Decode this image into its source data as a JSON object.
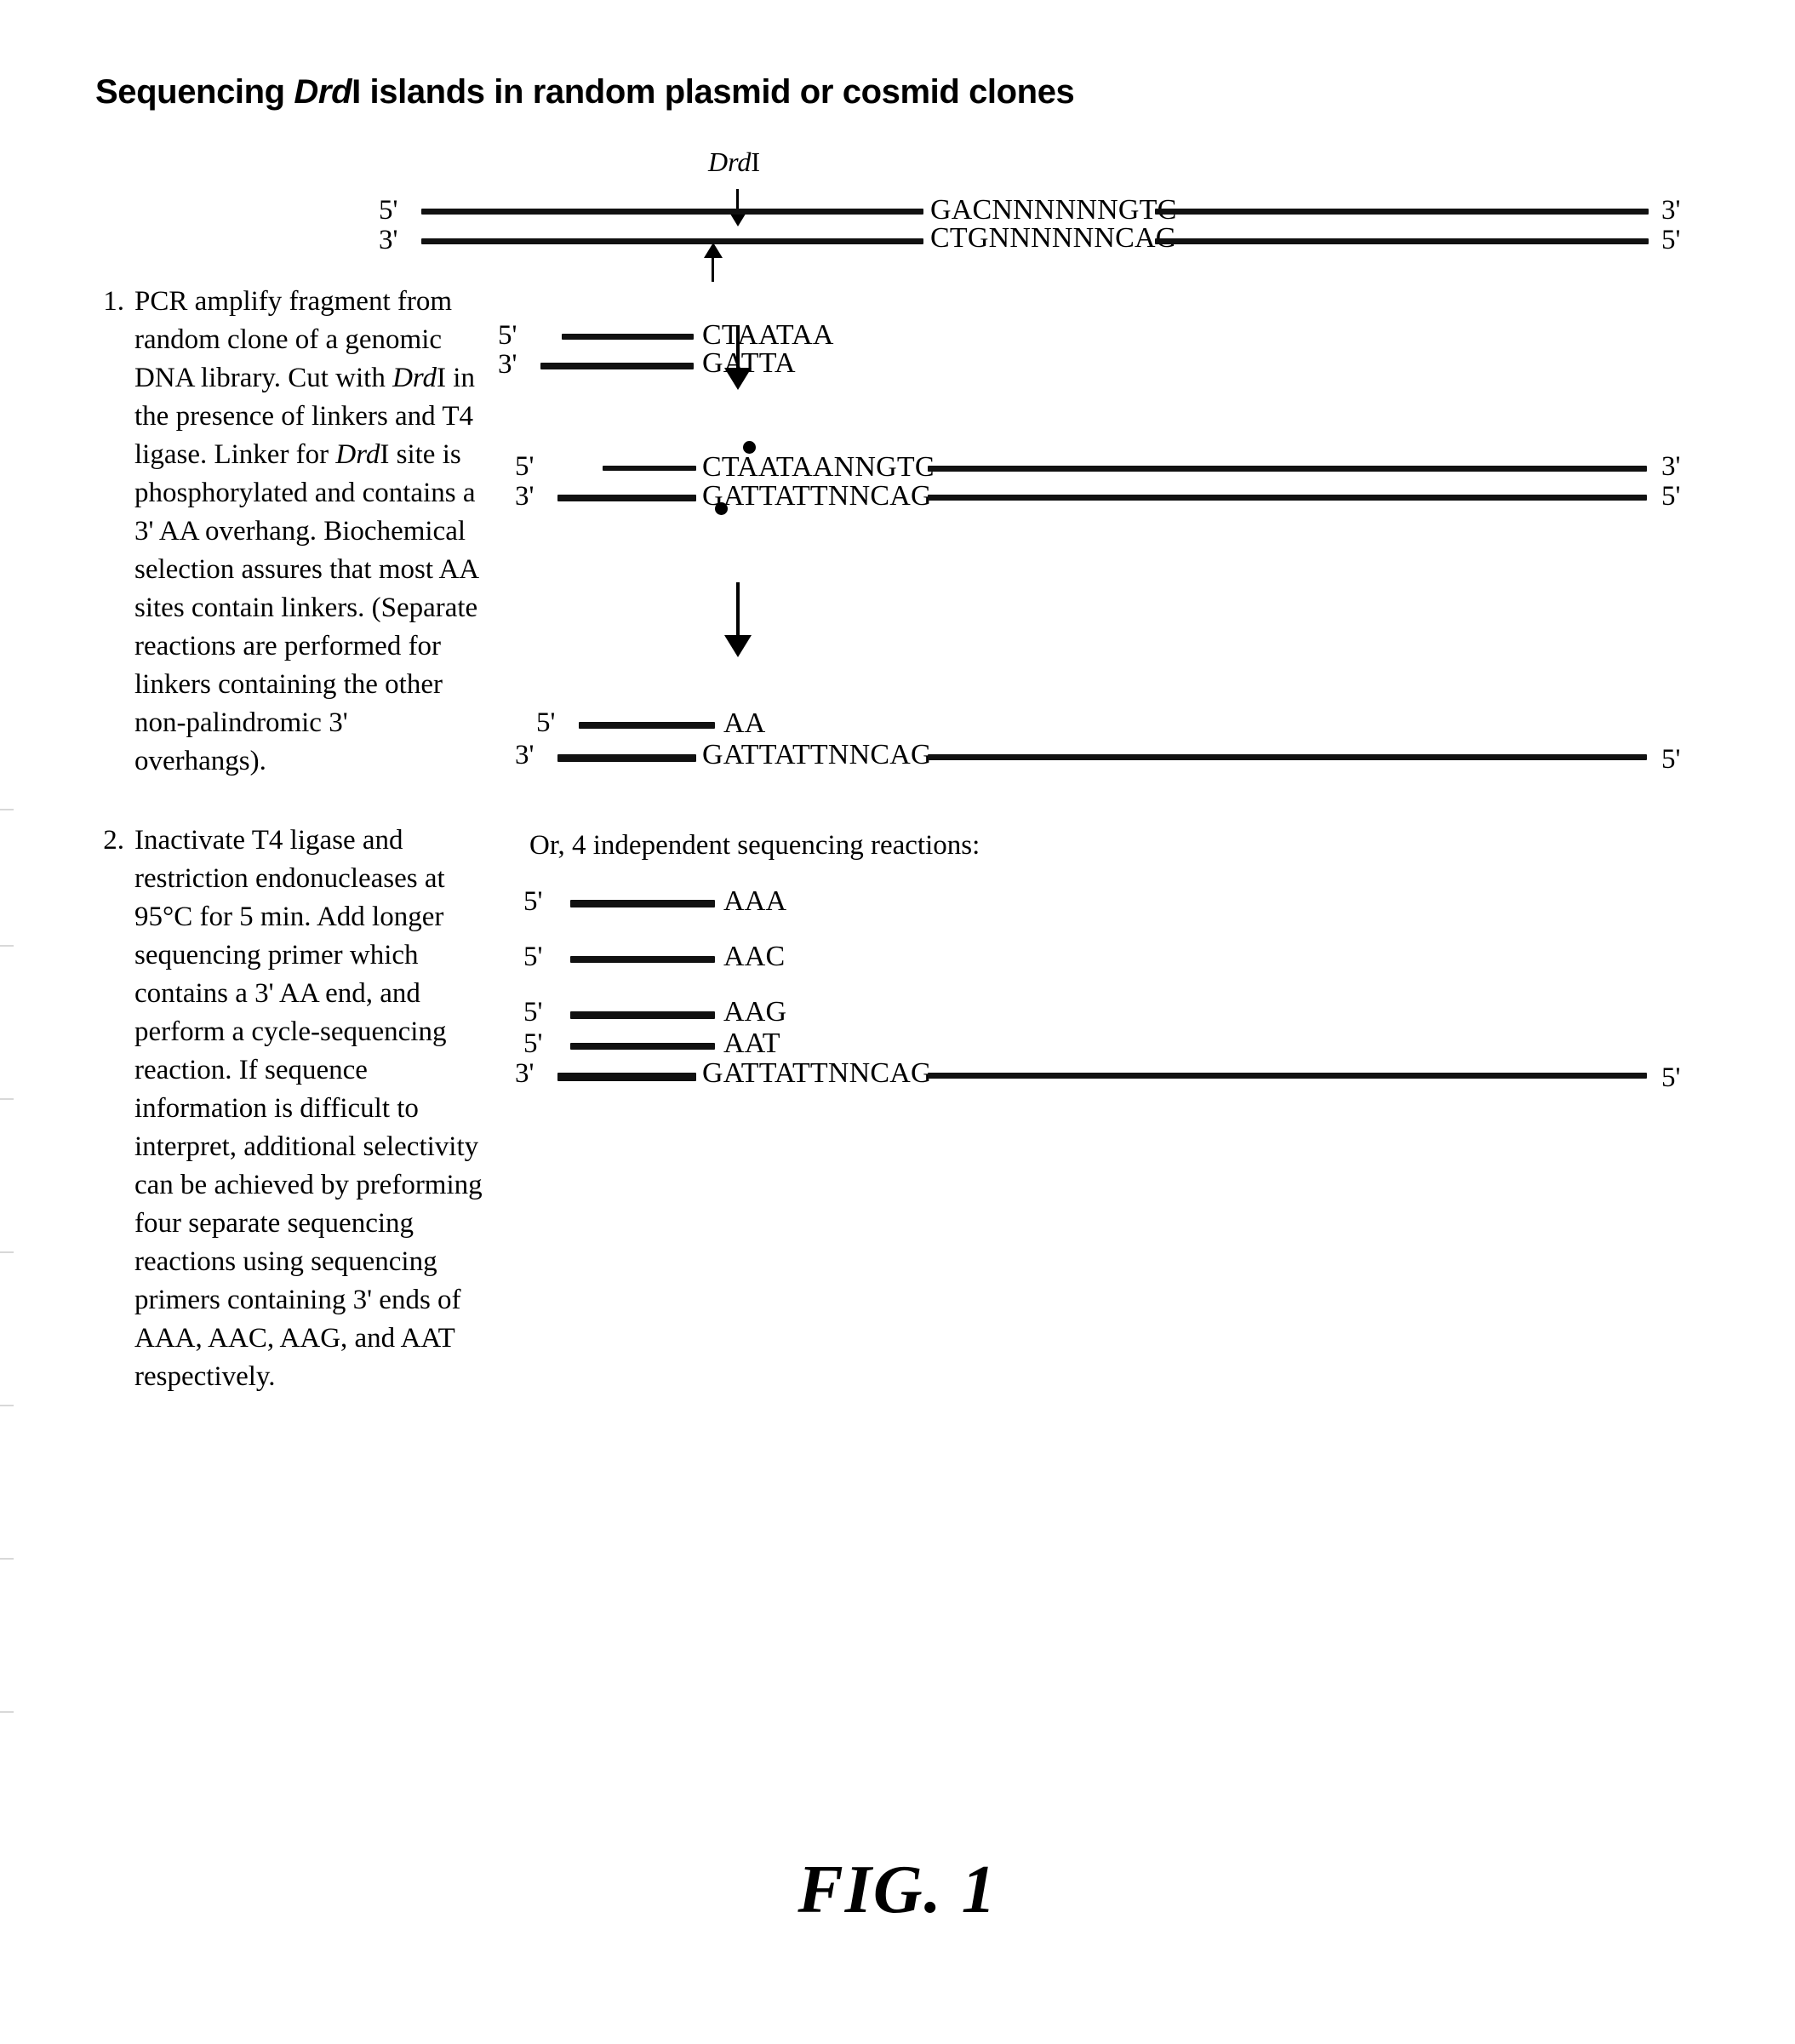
{
  "title": {
    "prefix": "Sequencing ",
    "italic": "Drd",
    "middle": "I",
    "suffix": " islands in random plasmid or cosmid clones"
  },
  "steps": [
    {
      "number": "1.",
      "segments": [
        {
          "text": "PCR amplify fragment from random clone of a genomic DNA library.  Cut with ",
          "italic": false
        },
        {
          "text": "Drd",
          "italic": true
        },
        {
          "text": "I in the presence of linkers and T4 ligase.  Linker for ",
          "italic": false
        },
        {
          "text": "Drd",
          "italic": true
        },
        {
          "text": "I site is phosphorylated and contains a 3' AA overhang.  Biochemical selection assures that most AA sites contain linkers.  (Separate reactions are performed for linkers containing the other non-palindromic 3' overhangs).",
          "italic": false
        }
      ]
    },
    {
      "number": "2.",
      "segments": [
        {
          "text": "Inactivate T4 ligase and restriction endonucleases at 95°C for 5 min.  Add longer sequencing primer which contains a 3' AA end, and perform a cycle-sequencing reaction.  If sequence information is difficult to interpret, additional selectivity can be achieved by preforming four separate sequencing reactions using sequencing primers containing 3' ends of AAA, AAC, AAG, and AAT respectively.",
          "italic": false
        }
      ]
    }
  ],
  "diagram": {
    "enzyme_label": {
      "italic": "Drd",
      "roman": "I"
    },
    "panel1": {
      "top_end_left": "5'",
      "top_end_right": "3'",
      "bottom_end_left": "3'",
      "bottom_end_right": "5'",
      "top_sequence": "GACNNNNNNGTC",
      "bottom_sequence": "CTGNNNNNNCAG"
    },
    "panel2": {
      "top_end_left": "5'",
      "bottom_end_left": "3'",
      "top_sequence": "CTAATAA",
      "bottom_sequence": "GATTA"
    },
    "panel3": {
      "top_end_left": "5'",
      "top_end_right": "3'",
      "bottom_end_left": "3'",
      "bottom_end_right": "5'",
      "top_sequence": "CTAATAANNGTC",
      "bottom_sequence": "GATTATTNNCAG"
    },
    "panel4": {
      "top_end_left": "5'",
      "bottom_end_left": "3'",
      "bottom_end_right": "5'",
      "top_sequence": "AA",
      "bottom_sequence": "GATTATTNNCAG"
    },
    "panel5": {
      "heading": "Or, 4 independent sequencing reactions:",
      "primers": [
        {
          "end_label": "5'",
          "sequence": "AAA"
        },
        {
          "end_label": "5'",
          "sequence": "AAC"
        },
        {
          "end_label": "5'",
          "sequence": "AAG"
        },
        {
          "end_label": "5'",
          "sequence": "AAT"
        }
      ],
      "template_end_left": "3'",
      "template_end_right": "5'",
      "template_sequence": "GATTATTNNCAG"
    }
  },
  "figure_caption": "FIG.  1"
}
